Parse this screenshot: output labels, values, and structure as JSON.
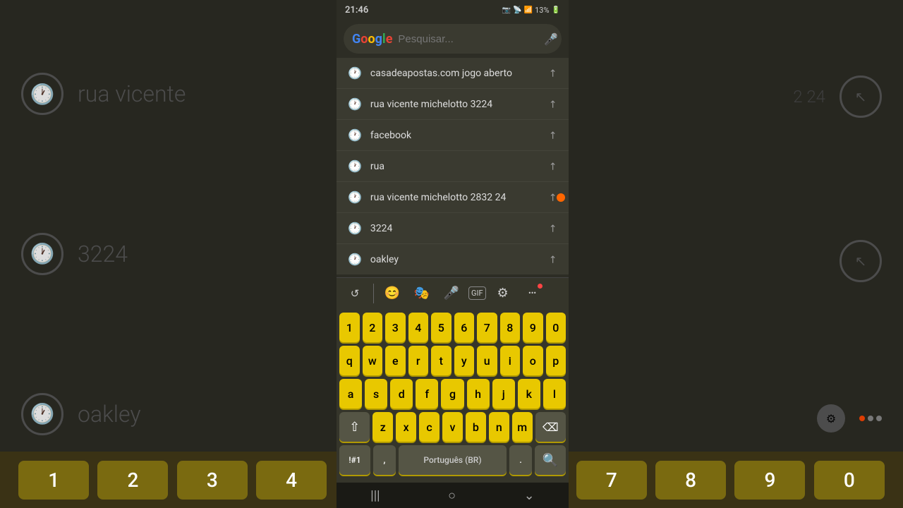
{
  "status_bar": {
    "time": "21:46",
    "battery": "13%",
    "icons": [
      "📷",
      "📡",
      "📶",
      "🔋"
    ]
  },
  "search": {
    "placeholder": "Pesquisar...",
    "google_logo": "G"
  },
  "suggestions": [
    {
      "id": 1,
      "text": "casadeapostas.com jogo aberto"
    },
    {
      "id": 2,
      "text": "rua vicente michelotto 3224"
    },
    {
      "id": 3,
      "text": "facebook"
    },
    {
      "id": 4,
      "text": "rua"
    },
    {
      "id": 5,
      "text": "rua vicente michelotto 2832 24"
    },
    {
      "id": 6,
      "text": "3224"
    },
    {
      "id": 7,
      "text": "oakley"
    }
  ],
  "keyboard": {
    "row0": [
      "1",
      "2",
      "3",
      "4",
      "5",
      "6",
      "7",
      "8",
      "9",
      "0"
    ],
    "row1": [
      "q",
      "w",
      "e",
      "r",
      "t",
      "y",
      "u",
      "i",
      "o",
      "p"
    ],
    "row2": [
      "a",
      "s",
      "d",
      "f",
      "g",
      "h",
      "j",
      "k",
      "l"
    ],
    "row3": [
      "z",
      "x",
      "c",
      "v",
      "b",
      "n",
      "m"
    ],
    "special_left": "!#1",
    "comma": ",",
    "space": "Português (BR)",
    "period": ".",
    "search_label": "🔍"
  },
  "bg": {
    "text1": "rua vicente",
    "text2": "3224",
    "text3": "oakley",
    "num1": "1",
    "num2": "2",
    "num3": "3",
    "num4": "4",
    "num5": "7",
    "num6": "8",
    "num7": "9",
    "num8": "0"
  },
  "nav": {
    "bars": "|||",
    "circle": "○",
    "chevron": "⌄"
  }
}
